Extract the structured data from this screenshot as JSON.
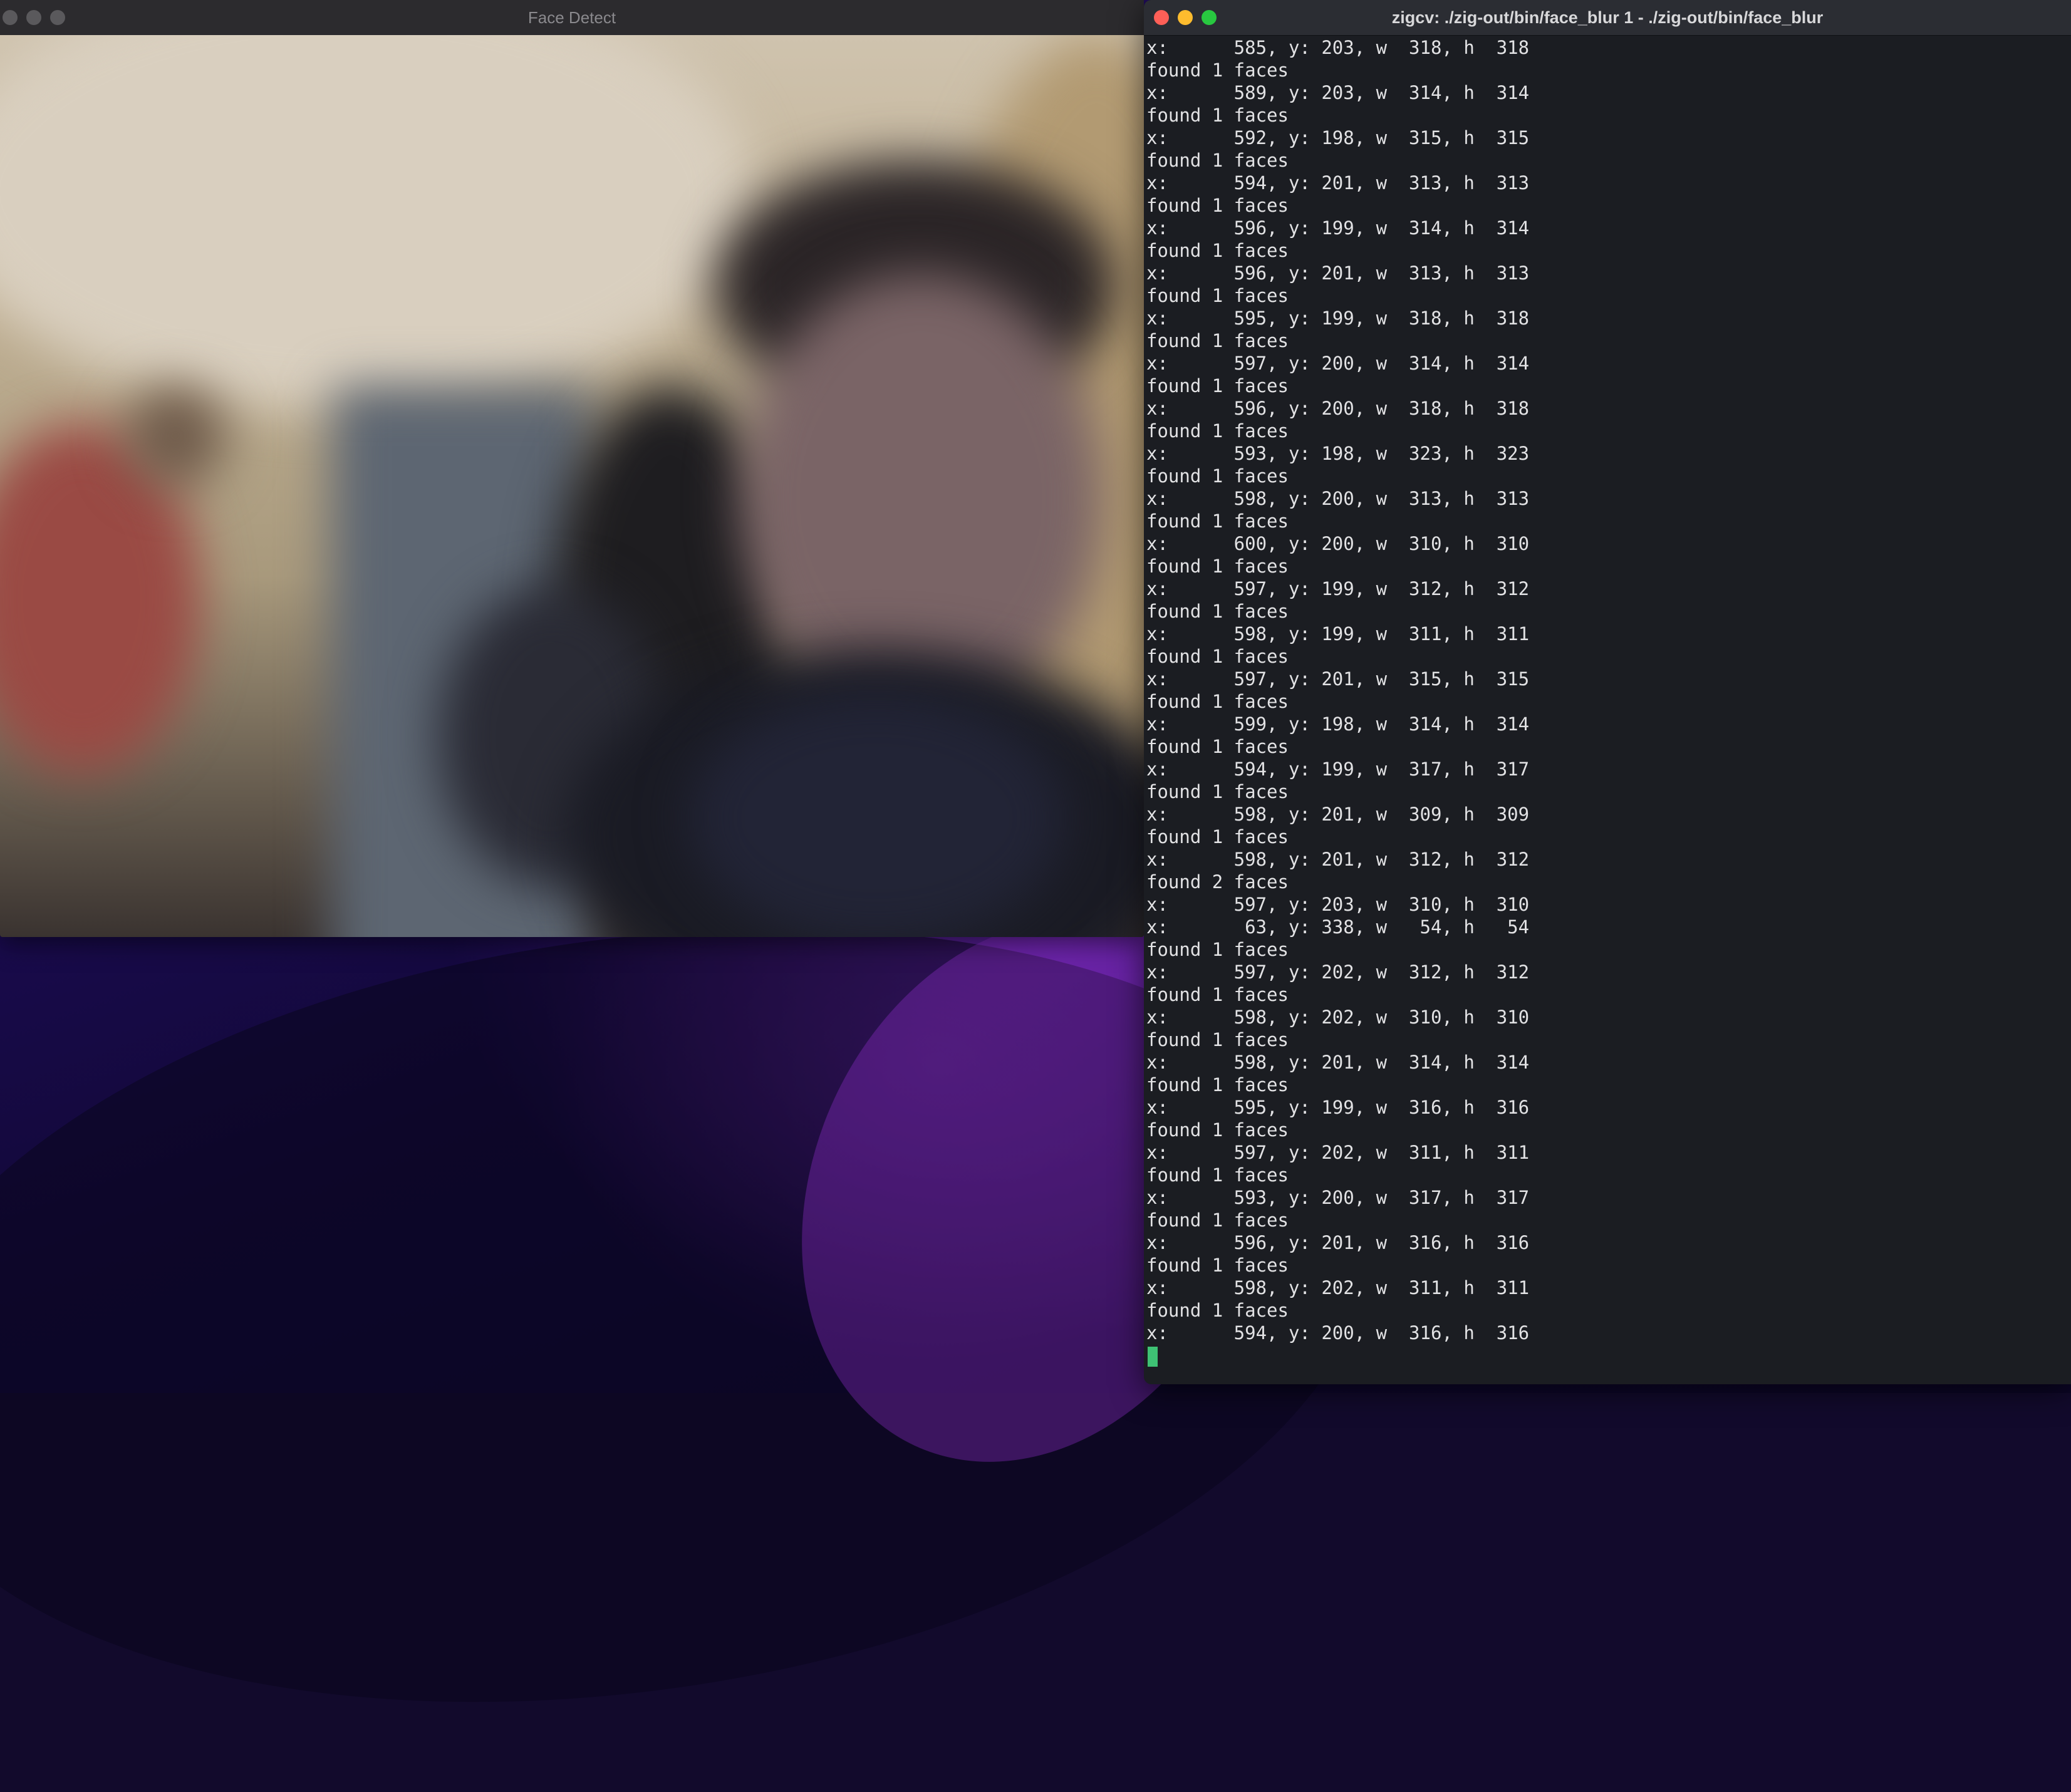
{
  "face_window": {
    "title": "Face Detect"
  },
  "terminal": {
    "title": "zigcv: ./zig-out/bin/face_blur 1 - ./zig-out/bin/face_blur",
    "lines": [
      "x:      585, y: 203, w  318, h  318",
      "found 1 faces",
      "x:      589, y: 203, w  314, h  314",
      "found 1 faces",
      "x:      592, y: 198, w  315, h  315",
      "found 1 faces",
      "x:      594, y: 201, w  313, h  313",
      "found 1 faces",
      "x:      596, y: 199, w  314, h  314",
      "found 1 faces",
      "x:      596, y: 201, w  313, h  313",
      "found 1 faces",
      "x:      595, y: 199, w  318, h  318",
      "found 1 faces",
      "x:      597, y: 200, w  314, h  314",
      "found 1 faces",
      "x:      596, y: 200, w  318, h  318",
      "found 1 faces",
      "x:      593, y: 198, w  323, h  323",
      "found 1 faces",
      "x:      598, y: 200, w  313, h  313",
      "found 1 faces",
      "x:      600, y: 200, w  310, h  310",
      "found 1 faces",
      "x:      597, y: 199, w  312, h  312",
      "found 1 faces",
      "x:      598, y: 199, w  311, h  311",
      "found 1 faces",
      "x:      597, y: 201, w  315, h  315",
      "found 1 faces",
      "x:      599, y: 198, w  314, h  314",
      "found 1 faces",
      "x:      594, y: 199, w  317, h  317",
      "found 1 faces",
      "x:      598, y: 201, w  309, h  309",
      "found 1 faces",
      "x:      598, y: 201, w  312, h  312",
      "found 2 faces",
      "x:      597, y: 203, w  310, h  310",
      "x:       63, y: 338, w   54, h   54",
      "found 1 faces",
      "x:      597, y: 202, w  312, h  312",
      "found 1 faces",
      "x:      598, y: 202, w  310, h  310",
      "found 1 faces",
      "x:      598, y: 201, w  314, h  314",
      "found 1 faces",
      "x:      595, y: 199, w  316, h  316",
      "found 1 faces",
      "x:      597, y: 202, w  311, h  311",
      "found 1 faces",
      "x:      593, y: 200, w  317, h  317",
      "found 1 faces",
      "x:      596, y: 201, w  316, h  316",
      "found 1 faces",
      "x:      598, y: 202, w  311, h  311",
      "found 1 faces",
      "x:      594, y: 200, w  316, h  316"
    ],
    "cursor_color": "#3ec274"
  }
}
